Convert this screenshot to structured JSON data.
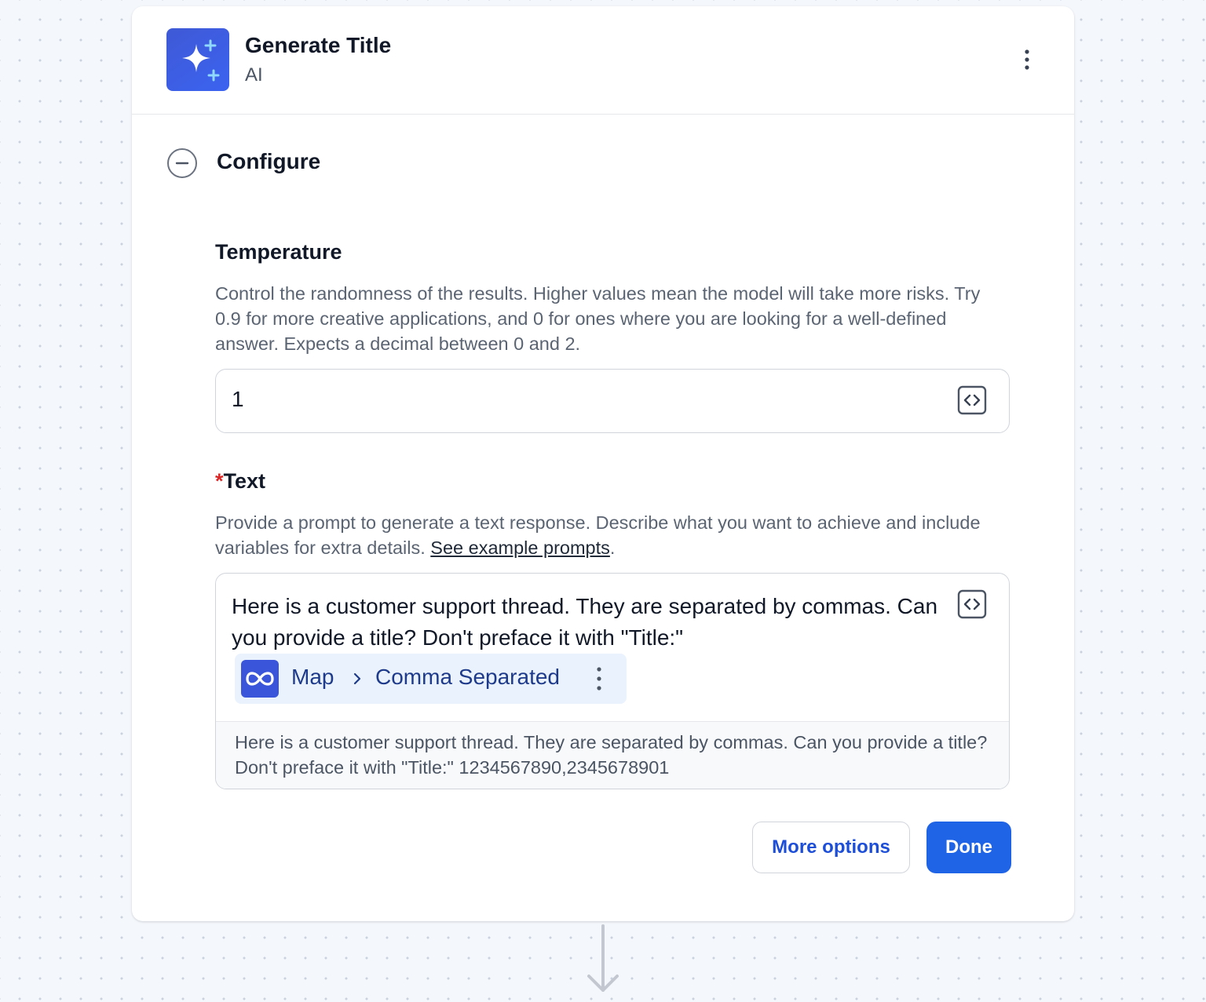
{
  "step": {
    "title": "Generate Title",
    "subtitle": "AI",
    "icon": "sparkles-icon",
    "menu_icon": "kebab-icon"
  },
  "section": {
    "title": "Configure",
    "expanded": true,
    "toggle_icon": "minus-circle-icon"
  },
  "fields": {
    "temperature": {
      "label": "Temperature",
      "description": "Control the randomness of the results. Higher values mean the model will take more risks. Try 0.9 for more creative applications, and 0 for ones where you are looking for a well-defined answer. Expects a decimal between 0 and 2.",
      "value": "1",
      "toggle_icon": "code-icon"
    },
    "text": {
      "required_mark": "*",
      "label": "Text",
      "description": "Provide a prompt to generate a text response. Describe what you want to achieve and include variables for extra details. ",
      "link_text": "See example prompts",
      "description_end": ".",
      "prompt": "Here is a customer support thread. They are separated by commas. Can you provide a title? Don't preface it with \"Title:\"",
      "variable": {
        "icon": "loop-icon",
        "part1": "Map",
        "separator_icon": "chevron-right-icon",
        "part2": "Comma Separated",
        "menu_icon": "kebab-icon"
      },
      "preview": "Here is a customer support thread. They are separated by commas. Can you provide a title? Don't preface it with \"Title:\" 1234567890,2345678901",
      "toggle_icon": "code-icon"
    }
  },
  "actions": {
    "more_options": "More options",
    "done": "Done"
  },
  "colors": {
    "primary": "#1f63e6",
    "icon_bg": "#3b5bdb",
    "chip_bg": "#eaf3fd",
    "chip_text": "#1e3a8a",
    "required": "#dc2626",
    "canvas": "#f4f7fb"
  },
  "canvas": {
    "connector_icon": "arrow-down-icon"
  }
}
